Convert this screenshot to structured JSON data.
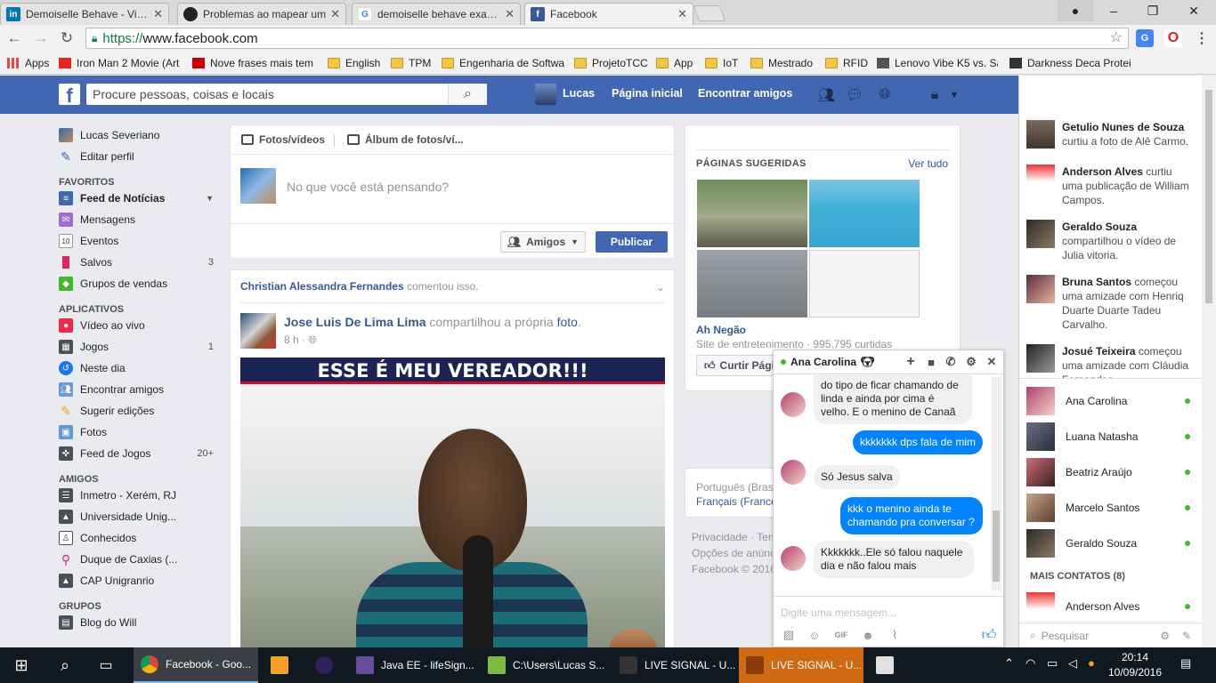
{
  "browser": {
    "tabs": [
      {
        "title": "Demoiselle Behave - Visão",
        "icon": "linkedin-icon",
        "color": "#0077b5"
      },
      {
        "title": "Problemas ao mapear um",
        "icon": "github-icon",
        "color": "#222222"
      },
      {
        "title": "demoiselle behave examp",
        "icon": "google-icon",
        "color": "#ffffff"
      },
      {
        "title": "Facebook",
        "icon": "facebook-icon",
        "color": "#3b5998"
      }
    ],
    "address_scheme": "https://",
    "address_host": "www.facebook.com",
    "bookmarks": [
      {
        "label": "Apps",
        "type": "apps"
      },
      {
        "label": "Iron Man 2 Movie (Art",
        "type": "site"
      },
      {
        "label": "Nove frases mais tem",
        "type": "site"
      },
      {
        "label": "English",
        "type": "folder"
      },
      {
        "label": "TPM",
        "type": "folder"
      },
      {
        "label": "Engenharia de Softwa",
        "type": "folder"
      },
      {
        "label": "ProjetoTCC",
        "type": "folder"
      },
      {
        "label": "App",
        "type": "folder"
      },
      {
        "label": "IoT",
        "type": "folder"
      },
      {
        "label": "Mestrado",
        "type": "folder"
      },
      {
        "label": "RFID",
        "type": "folder"
      },
      {
        "label": "Lenovo Vibe K5 vs. Sa",
        "type": "site"
      },
      {
        "label": "Darkness Deca Protei",
        "type": "site"
      }
    ]
  },
  "fb": {
    "search_placeholder": "Procure pessoas, coisas e locais",
    "nav_user": "Lucas",
    "nav_home": "Página inicial",
    "nav_find_friends": "Encontrar amigos",
    "brand_color": "#4267b2"
  },
  "leftnav": {
    "profile_name": "Lucas Severiano",
    "edit_profile": "Editar perfil",
    "favorites_header": "FAVORITOS",
    "favorites": [
      {
        "label": "Feed de Notícias",
        "count": ""
      },
      {
        "label": "Mensagens",
        "count": ""
      },
      {
        "label": "Eventos",
        "count": ""
      },
      {
        "label": "Salvos",
        "count": "3"
      },
      {
        "label": "Grupos de vendas",
        "count": ""
      }
    ],
    "apps_header": "APLICATIVOS",
    "apps": [
      {
        "label": "Vídeo ao vivo",
        "count": ""
      },
      {
        "label": "Jogos",
        "count": "1"
      },
      {
        "label": "Neste dia",
        "count": ""
      },
      {
        "label": "Encontrar amigos",
        "count": ""
      },
      {
        "label": "Sugerir edições",
        "count": ""
      },
      {
        "label": "Fotos",
        "count": ""
      },
      {
        "label": "Feed de Jogos",
        "count": "20+"
      }
    ],
    "friends_header": "AMIGOS",
    "friends": [
      {
        "label": "Inmetro - Xerém, RJ"
      },
      {
        "label": "Universidade Unig..."
      },
      {
        "label": "Conhecidos"
      },
      {
        "label": "Duque de Caxias (..."
      },
      {
        "label": "CAP Unigranrio"
      }
    ],
    "groups_header": "GRUPOS",
    "groups": [
      {
        "label": "Blog do Will"
      }
    ]
  },
  "composer": {
    "tab_photos": "Fotos/vídeos",
    "tab_album": "Álbum de fotos/ví...",
    "prompt": "No que você está pensando?",
    "audience": "Amigos",
    "publish": "Publicar"
  },
  "post": {
    "story_actor": "Christian Alessandra Fernandes",
    "story_action": "comentou isso.",
    "author": "Jose Luis De Lima Lima",
    "action_prefix": "compartilhou a própria",
    "action_link": "foto",
    "time": "8 h ·",
    "photo_banner": "ESSE É MEU VEREADOR!!!"
  },
  "suggested": {
    "header": "PÁGINAS SUGERIDAS",
    "see_all": "Ver tudo",
    "page_name": "Ah Negão",
    "page_category": "Site de entretenimento · 995.795 curtidas",
    "like_button": "Curtir Página"
  },
  "languages": {
    "current": "Português (Brasil)",
    "other": "Français (France)"
  },
  "footer_links": [
    "Privacidade · Termos",
    "Opções de anúncio",
    "Facebook © 2016"
  ],
  "ticker": [
    {
      "name": "Getulio Nunes de Souza",
      "text": "curtiu a foto de Alê Carmo."
    },
    {
      "name": "Anderson Alves",
      "text": "curtiu uma publicação de William Campos."
    },
    {
      "name": "Geraldo Souza",
      "text": "compartilhou o vídeo de Julia vitoria."
    },
    {
      "name": "Bruna Santos",
      "text": "começou uma amizade com Henriq Duarte Duarte Tadeu Carvalho."
    },
    {
      "name": "Josué Teixeira",
      "text": "começou uma amizade com Cláudia Fernandes."
    }
  ],
  "contacts": [
    {
      "name": "Ana Carolina"
    },
    {
      "name": "Luana Natasha"
    },
    {
      "name": "Beatriz Araújo"
    },
    {
      "name": "Marcelo Santos"
    },
    {
      "name": "Geraldo Souza"
    }
  ],
  "more_contacts_header": "MAIS CONTATOS (8)",
  "more_contacts": [
    {
      "name": "Anderson Alves"
    }
  ],
  "chat_search_placeholder": "Pesquisar",
  "chat": {
    "name": "Ana Carolina",
    "messages": [
      {
        "from": "in",
        "text": "do tipo de ficar chamando de linda e ainda por cima é velho. E o menino de Canaã"
      },
      {
        "from": "out",
        "text": "kkkkkkk dps fala de mim"
      },
      {
        "from": "in",
        "text": "Só Jesus salva"
      },
      {
        "from": "out",
        "text": "kkk o menino ainda te chamando pra conversar ?"
      },
      {
        "from": "in",
        "text": "Kkkkkkk..Ele só falou naquele dia e não falou mais"
      }
    ],
    "input_placeholder": "Digite uma mensagem..."
  },
  "taskbar": {
    "items": [
      {
        "label": "Facebook - Goo..."
      },
      {
        "label": "Java EE - lifeSign..."
      },
      {
        "label": "C:\\Users\\Lucas S..."
      },
      {
        "label": "LIVE SIGNAL - U..."
      },
      {
        "label": "LIVE SIGNAL - U..."
      }
    ],
    "time": "20:14",
    "date": "10/09/2016"
  }
}
